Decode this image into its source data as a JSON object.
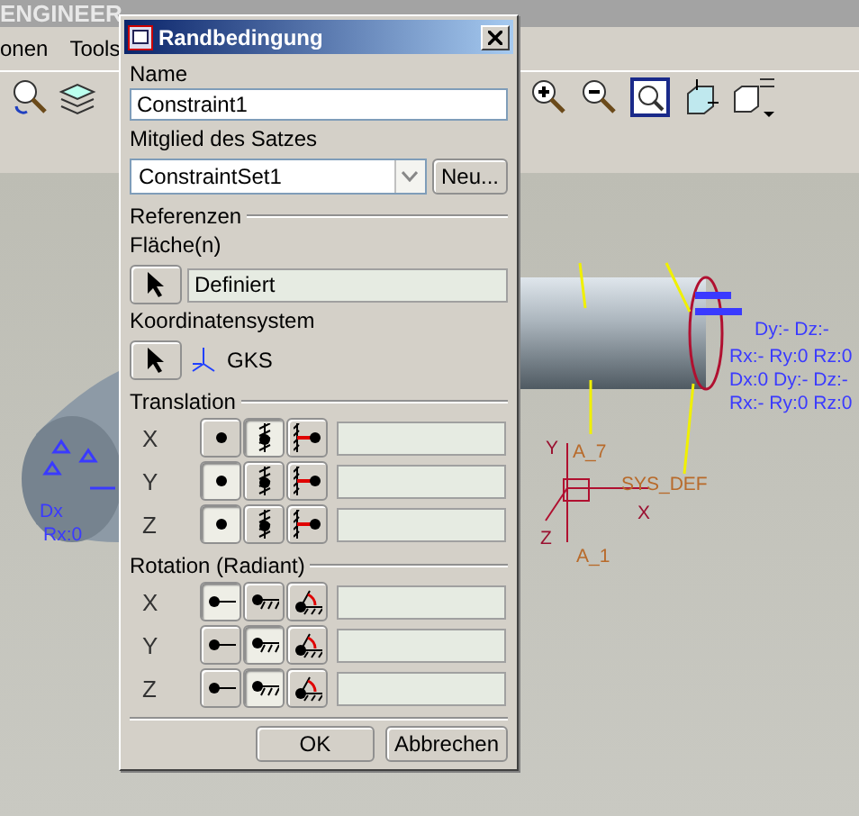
{
  "app": {
    "title": "ENGINEER",
    "menu": [
      {
        "label": "onen"
      },
      {
        "label": "Tools"
      }
    ]
  },
  "viewport": {
    "labels": [
      {
        "text": "Dy:- Dz:-",
        "kind": "constraint"
      },
      {
        "text": "Rx:- Ry:0 Rz:0",
        "kind": "constraint"
      },
      {
        "text": "Dx:0 Dy:- Dz:-",
        "kind": "constraint"
      },
      {
        "text": "Rx:- Ry:0 Rz:0",
        "kind": "constraint"
      },
      {
        "text": "Dx",
        "kind": "constraint"
      },
      {
        "text": "Rx:0",
        "kind": "constraint"
      },
      {
        "text": "SYS_DEF",
        "kind": "csys"
      },
      {
        "text": "A_7",
        "kind": "csys"
      },
      {
        "text": "A_1",
        "kind": "csys"
      },
      {
        "text": "X",
        "kind": "axis"
      },
      {
        "text": "Y",
        "kind": "axis"
      },
      {
        "text": "Z",
        "kind": "axis"
      }
    ]
  },
  "dialog": {
    "title": "Randbedingung",
    "name_label": "Name",
    "name_value": "Constraint1",
    "set_label": "Mitglied des Satzes",
    "set_value": "ConstraintSet1",
    "new_button": "Neu...",
    "references": {
      "heading": "Referenzen",
      "surfaces_label": "Fläche(n)",
      "surfaces_value": "Definiert",
      "csys_label": "Koordinatensystem",
      "csys_value": "GKS"
    },
    "translation": {
      "heading": "Translation",
      "rows": [
        {
          "axis": "X",
          "options": [
            {
              "kind": "free",
              "selected": false
            },
            {
              "kind": "fixed",
              "selected": true
            },
            {
              "kind": "prescribed",
              "selected": false
            }
          ]
        },
        {
          "axis": "Y",
          "options": [
            {
              "kind": "free",
              "selected": true
            },
            {
              "kind": "fixed",
              "selected": false
            },
            {
              "kind": "prescribed",
              "selected": false
            }
          ]
        },
        {
          "axis": "Z",
          "options": [
            {
              "kind": "free",
              "selected": true
            },
            {
              "kind": "fixed",
              "selected": false
            },
            {
              "kind": "prescribed",
              "selected": false
            }
          ]
        }
      ]
    },
    "rotation": {
      "heading": "Rotation (Radiant)",
      "rows": [
        {
          "axis": "X",
          "options": [
            {
              "kind": "free",
              "selected": true
            },
            {
              "kind": "fixed",
              "selected": false
            },
            {
              "kind": "prescribed",
              "selected": false
            }
          ]
        },
        {
          "axis": "Y",
          "options": [
            {
              "kind": "free",
              "selected": false
            },
            {
              "kind": "fixed",
              "selected": true
            },
            {
              "kind": "prescribed",
              "selected": false
            }
          ]
        },
        {
          "axis": "Z",
          "options": [
            {
              "kind": "free",
              "selected": false
            },
            {
              "kind": "fixed",
              "selected": true
            },
            {
              "kind": "prescribed",
              "selected": false
            }
          ]
        }
      ]
    },
    "buttons": [
      "OK",
      "Abbrechen"
    ]
  }
}
